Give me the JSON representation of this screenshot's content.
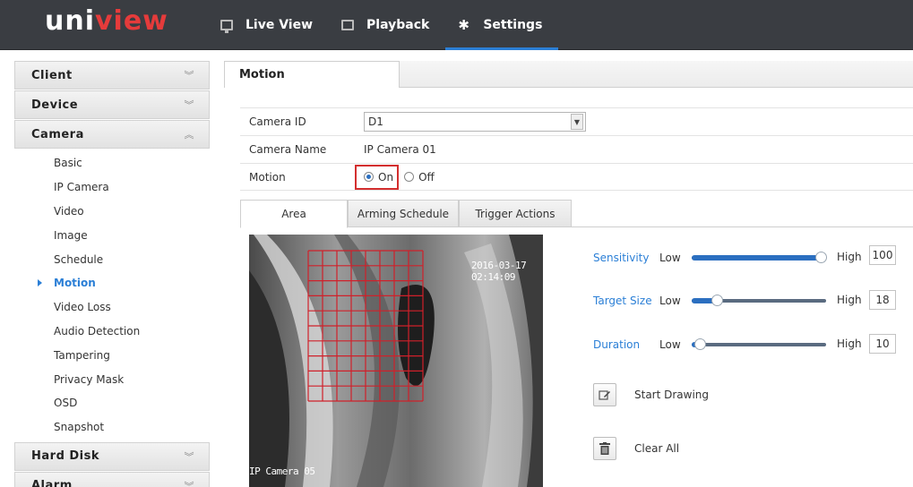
{
  "brand": {
    "name_part1": "uni",
    "name_part2": "view"
  },
  "nav": [
    {
      "label": "Live View",
      "icon": "monitor-icon"
    },
    {
      "label": "Playback",
      "icon": "film-icon"
    },
    {
      "label": "Settings",
      "icon": "gear-icon",
      "active": true
    }
  ],
  "sidebar": {
    "client": "Client",
    "device": "Device",
    "camera": "Camera",
    "camera_items": [
      "Basic",
      "IP Camera",
      "Video",
      "Image",
      "Schedule",
      "Motion",
      "Video Loss",
      "Audio Detection",
      "Tampering",
      "Privacy Mask",
      "OSD",
      "Snapshot"
    ],
    "active_item": "Motion",
    "hard_disk": "Hard Disk",
    "alarm": "Alarm"
  },
  "page": {
    "title": "Motion"
  },
  "form": {
    "camera_id_label": "Camera ID",
    "camera_id_value": "D1",
    "camera_name_label": "Camera Name",
    "camera_name_value": "IP Camera 01",
    "motion_label": "Motion",
    "motion_on": "On",
    "motion_off": "Off",
    "motion_selected": "On"
  },
  "subtabs": [
    "Area",
    "Arming Schedule",
    "Trigger Actions"
  ],
  "video": {
    "timestamp": "2016-03-17 02:14:09",
    "camera_label": "IP Camera 05",
    "grid_cols": 8,
    "grid_rows": 10
  },
  "sliders": [
    {
      "name": "Sensitivity",
      "low": "Low",
      "high": "High",
      "value": "100",
      "fraction": 1.0
    },
    {
      "name": "Target Size",
      "low": "Low",
      "high": "High",
      "value": "18",
      "fraction": 0.18
    },
    {
      "name": "Duration",
      "low": "Low",
      "high": "High",
      "value": "10",
      "fraction": 0.05
    }
  ],
  "actions": {
    "start_drawing": "Start Drawing",
    "clear_all": "Clear All"
  },
  "colors": {
    "accent": "#2b7fd6",
    "topbar": "#3a3d42",
    "highlight_red": "#d32f2f",
    "grid_red": "#d0202a"
  }
}
